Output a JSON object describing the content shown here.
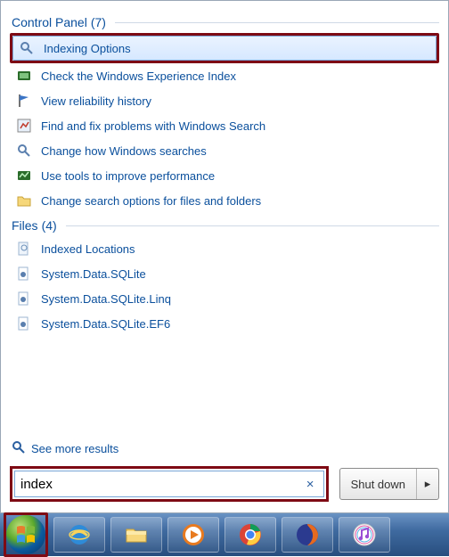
{
  "sections": {
    "control_panel": {
      "title": "Control Panel",
      "count": "(7)",
      "items": [
        {
          "label": "Indexing Options",
          "icon": "indexing-icon",
          "selected": true,
          "highlighted": true
        },
        {
          "label": "Check the Windows Experience Index",
          "icon": "experience-icon"
        },
        {
          "label": "View reliability history",
          "icon": "flag-icon"
        },
        {
          "label": "Find and fix problems with Windows Search",
          "icon": "troubleshoot-icon"
        },
        {
          "label": "Change how Windows searches",
          "icon": "indexing-icon"
        },
        {
          "label": "Use tools to improve performance",
          "icon": "performance-icon"
        },
        {
          "label": "Change search options for files and folders",
          "icon": "folder-options-icon"
        }
      ]
    },
    "files": {
      "title": "Files",
      "count": "(4)",
      "items": [
        {
          "label": "Indexed Locations",
          "icon": "search-doc-icon"
        },
        {
          "label": "System.Data.SQLite",
          "icon": "config-file-icon"
        },
        {
          "label": "System.Data.SQLite.Linq",
          "icon": "config-file-icon"
        },
        {
          "label": "System.Data.SQLite.EF6",
          "icon": "config-file-icon"
        }
      ]
    }
  },
  "see_more": "See more results",
  "search": {
    "value": "index",
    "clear": "×"
  },
  "shutdown": {
    "label": "Shut down",
    "arrow": "▸"
  },
  "taskbar": {
    "items": [
      {
        "name": "start-button",
        "highlighted": true
      },
      {
        "name": "internet-explorer"
      },
      {
        "name": "file-explorer"
      },
      {
        "name": "media-player"
      },
      {
        "name": "chrome"
      },
      {
        "name": "firefox"
      },
      {
        "name": "itunes"
      }
    ]
  }
}
